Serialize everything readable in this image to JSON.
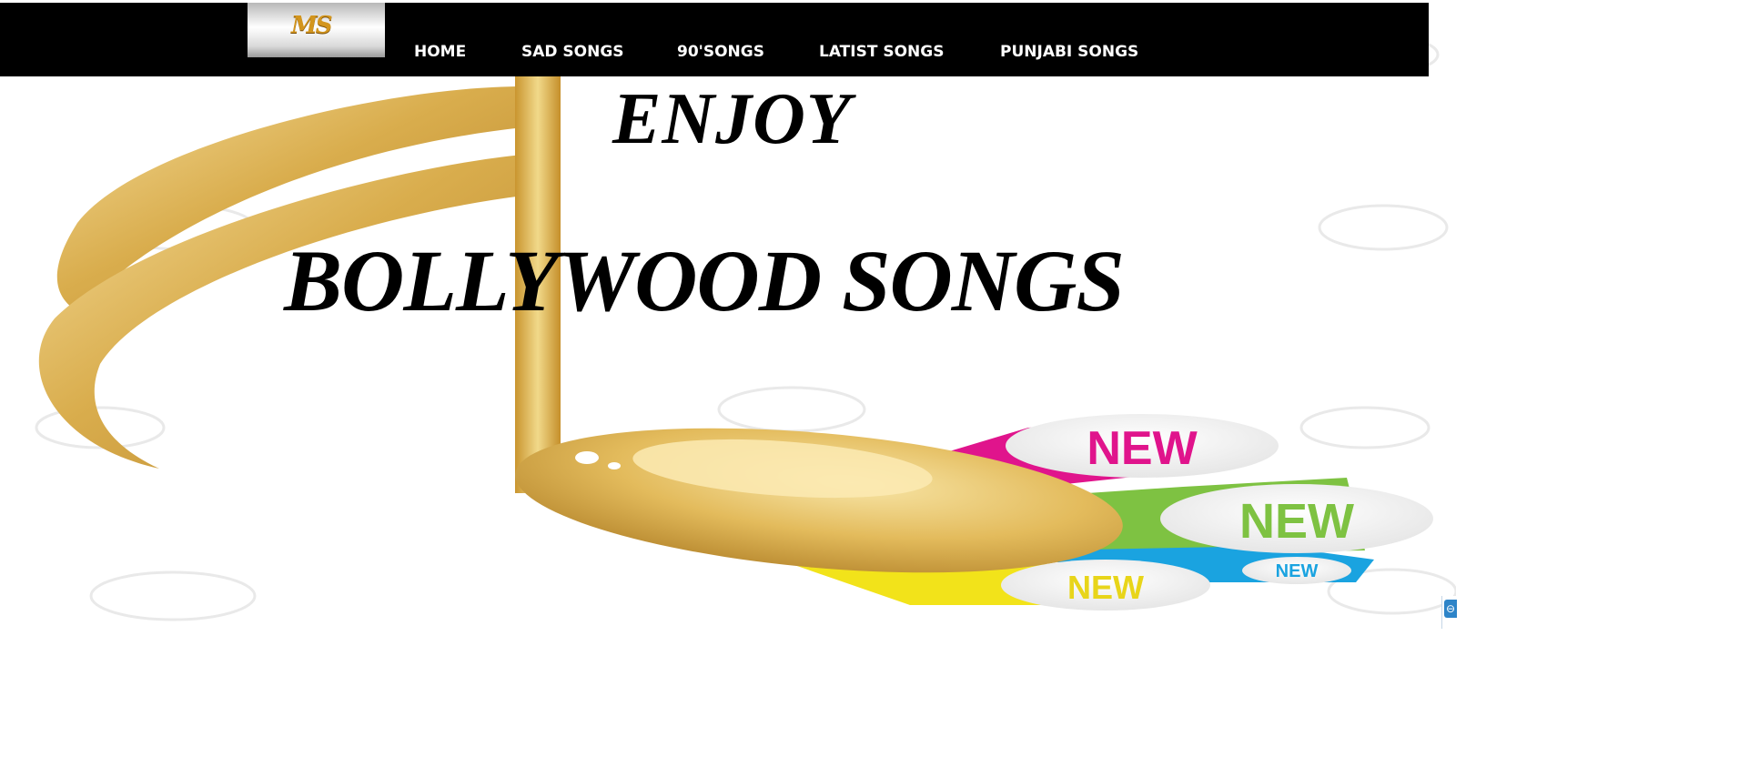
{
  "brand": {
    "logo_text": "MS"
  },
  "nav": {
    "items": [
      {
        "label": "HOME"
      },
      {
        "label": "SAD SONGS"
      },
      {
        "label": "90'SONGS"
      },
      {
        "label": "LATIST SONGS"
      },
      {
        "label": "PUNJABI SONGS"
      }
    ]
  },
  "hero": {
    "line1": "ENJOY",
    "line2": "BOLLYWOOD SONGS",
    "badges": [
      "NEW",
      "NEW",
      "NEW",
      "NEW"
    ],
    "edge_glyph": "⊖"
  },
  "colors": {
    "navbar": "#000000",
    "gold": "#d9ad4d",
    "badge_magenta": "#e0148c",
    "badge_green": "#7ec242",
    "badge_blue": "#1aa3e0",
    "badge_yellow": "#f2e31a"
  }
}
